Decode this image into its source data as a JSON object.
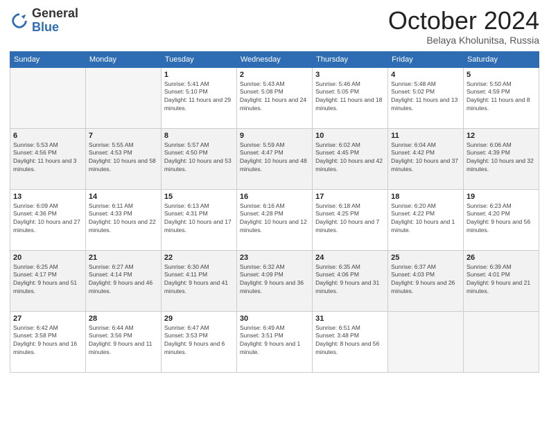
{
  "logo": {
    "general": "General",
    "blue": "Blue"
  },
  "header": {
    "month": "October 2024",
    "location": "Belaya Kholunitsa, Russia"
  },
  "weekdays": [
    "Sunday",
    "Monday",
    "Tuesday",
    "Wednesday",
    "Thursday",
    "Friday",
    "Saturday"
  ],
  "weeks": [
    [
      {
        "day": "",
        "info": ""
      },
      {
        "day": "",
        "info": ""
      },
      {
        "day": "1",
        "info": "Sunrise: 5:41 AM\nSunset: 5:10 PM\nDaylight: 11 hours and 29 minutes."
      },
      {
        "day": "2",
        "info": "Sunrise: 5:43 AM\nSunset: 5:08 PM\nDaylight: 11 hours and 24 minutes."
      },
      {
        "day": "3",
        "info": "Sunrise: 5:46 AM\nSunset: 5:05 PM\nDaylight: 11 hours and 18 minutes."
      },
      {
        "day": "4",
        "info": "Sunrise: 5:48 AM\nSunset: 5:02 PM\nDaylight: 11 hours and 13 minutes."
      },
      {
        "day": "5",
        "info": "Sunrise: 5:50 AM\nSunset: 4:59 PM\nDaylight: 11 hours and 8 minutes."
      }
    ],
    [
      {
        "day": "6",
        "info": "Sunrise: 5:53 AM\nSunset: 4:56 PM\nDaylight: 11 hours and 3 minutes."
      },
      {
        "day": "7",
        "info": "Sunrise: 5:55 AM\nSunset: 4:53 PM\nDaylight: 10 hours and 58 minutes."
      },
      {
        "day": "8",
        "info": "Sunrise: 5:57 AM\nSunset: 4:50 PM\nDaylight: 10 hours and 53 minutes."
      },
      {
        "day": "9",
        "info": "Sunrise: 5:59 AM\nSunset: 4:47 PM\nDaylight: 10 hours and 48 minutes."
      },
      {
        "day": "10",
        "info": "Sunrise: 6:02 AM\nSunset: 4:45 PM\nDaylight: 10 hours and 42 minutes."
      },
      {
        "day": "11",
        "info": "Sunrise: 6:04 AM\nSunset: 4:42 PM\nDaylight: 10 hours and 37 minutes."
      },
      {
        "day": "12",
        "info": "Sunrise: 6:06 AM\nSunset: 4:39 PM\nDaylight: 10 hours and 32 minutes."
      }
    ],
    [
      {
        "day": "13",
        "info": "Sunrise: 6:09 AM\nSunset: 4:36 PM\nDaylight: 10 hours and 27 minutes."
      },
      {
        "day": "14",
        "info": "Sunrise: 6:11 AM\nSunset: 4:33 PM\nDaylight: 10 hours and 22 minutes."
      },
      {
        "day": "15",
        "info": "Sunrise: 6:13 AM\nSunset: 4:31 PM\nDaylight: 10 hours and 17 minutes."
      },
      {
        "day": "16",
        "info": "Sunrise: 6:16 AM\nSunset: 4:28 PM\nDaylight: 10 hours and 12 minutes."
      },
      {
        "day": "17",
        "info": "Sunrise: 6:18 AM\nSunset: 4:25 PM\nDaylight: 10 hours and 7 minutes."
      },
      {
        "day": "18",
        "info": "Sunrise: 6:20 AM\nSunset: 4:22 PM\nDaylight: 10 hours and 1 minute."
      },
      {
        "day": "19",
        "info": "Sunrise: 6:23 AM\nSunset: 4:20 PM\nDaylight: 9 hours and 56 minutes."
      }
    ],
    [
      {
        "day": "20",
        "info": "Sunrise: 6:25 AM\nSunset: 4:17 PM\nDaylight: 9 hours and 51 minutes."
      },
      {
        "day": "21",
        "info": "Sunrise: 6:27 AM\nSunset: 4:14 PM\nDaylight: 9 hours and 46 minutes."
      },
      {
        "day": "22",
        "info": "Sunrise: 6:30 AM\nSunset: 4:11 PM\nDaylight: 9 hours and 41 minutes."
      },
      {
        "day": "23",
        "info": "Sunrise: 6:32 AM\nSunset: 4:09 PM\nDaylight: 9 hours and 36 minutes."
      },
      {
        "day": "24",
        "info": "Sunrise: 6:35 AM\nSunset: 4:06 PM\nDaylight: 9 hours and 31 minutes."
      },
      {
        "day": "25",
        "info": "Sunrise: 6:37 AM\nSunset: 4:03 PM\nDaylight: 9 hours and 26 minutes."
      },
      {
        "day": "26",
        "info": "Sunrise: 6:39 AM\nSunset: 4:01 PM\nDaylight: 9 hours and 21 minutes."
      }
    ],
    [
      {
        "day": "27",
        "info": "Sunrise: 6:42 AM\nSunset: 3:58 PM\nDaylight: 9 hours and 16 minutes."
      },
      {
        "day": "28",
        "info": "Sunrise: 6:44 AM\nSunset: 3:56 PM\nDaylight: 9 hours and 11 minutes."
      },
      {
        "day": "29",
        "info": "Sunrise: 6:47 AM\nSunset: 3:53 PM\nDaylight: 9 hours and 6 minutes."
      },
      {
        "day": "30",
        "info": "Sunrise: 6:49 AM\nSunset: 3:51 PM\nDaylight: 9 hours and 1 minute."
      },
      {
        "day": "31",
        "info": "Sunrise: 6:51 AM\nSunset: 3:48 PM\nDaylight: 8 hours and 56 minutes."
      },
      {
        "day": "",
        "info": ""
      },
      {
        "day": "",
        "info": ""
      }
    ]
  ]
}
